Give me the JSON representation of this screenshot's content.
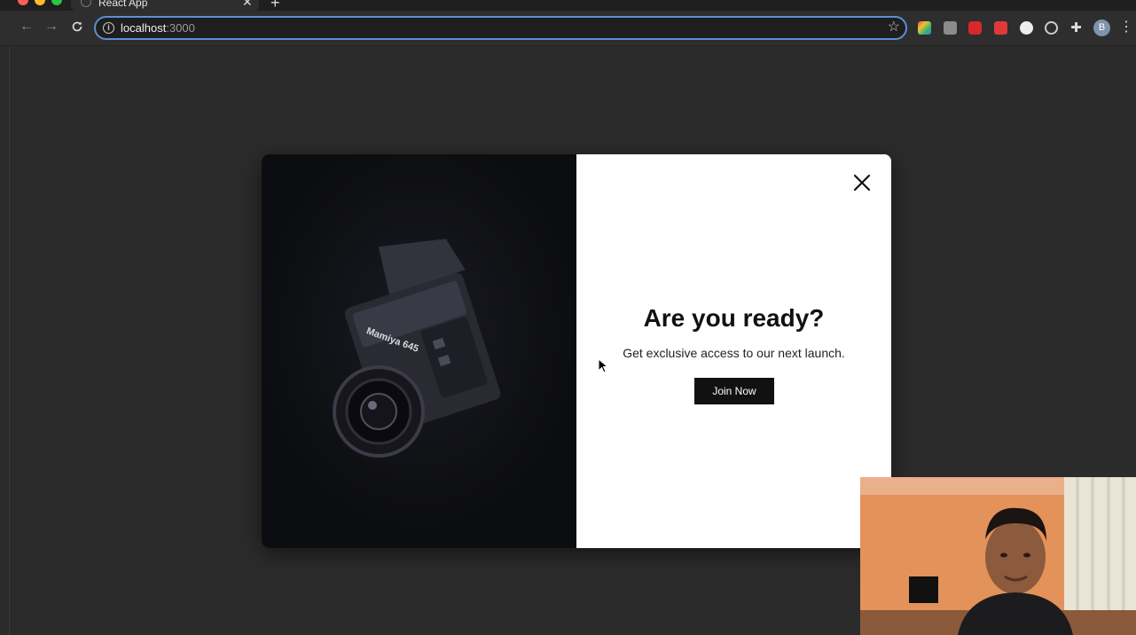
{
  "browser": {
    "tab_title": "React App",
    "url_host": "localhost",
    "url_port": ":3000",
    "profile_initial": "B"
  },
  "modal": {
    "title": "Are you ready?",
    "subtitle": "Get exclusive access to our next launch.",
    "join_label": "Join Now",
    "camera_text": "Mamiya 645"
  },
  "colors": {
    "accent_focus": "#5b8fd4",
    "modal_image_bg": "#0c0d10",
    "button_bg": "#111111",
    "page_bg": "#2b2b2b"
  },
  "icons": [
    "back-icon",
    "forward-icon",
    "reload-icon",
    "info-icon",
    "star-icon",
    "extension-icon",
    "puzzle-icon",
    "menu-icon",
    "close-icon",
    "cursor-icon"
  ]
}
